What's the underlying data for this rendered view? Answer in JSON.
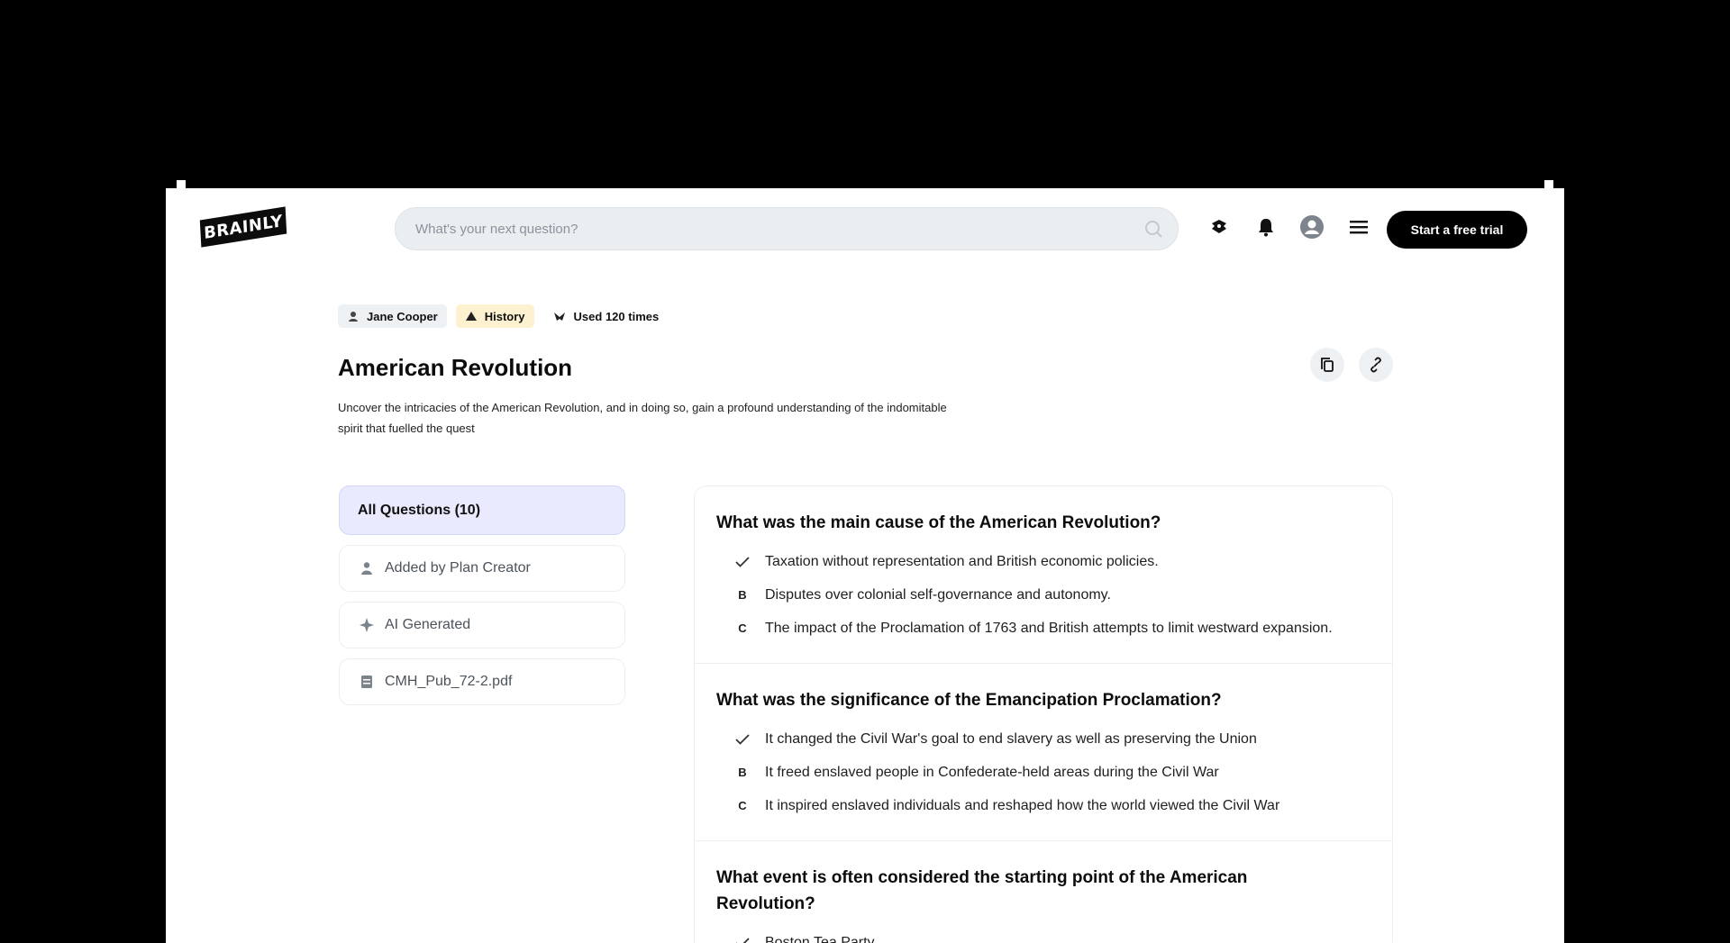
{
  "header": {
    "logo_text": "BRAINLY",
    "search_placeholder": "What's your next question?",
    "cta_label": "Start a free trial"
  },
  "meta": {
    "author": "Jane Cooper",
    "subject": "History",
    "usage": "Used 120 times"
  },
  "page": {
    "title": "American Revolution",
    "description": "Uncover the intricacies of the American Revolution, and in doing so, gain a profound understanding of the indomitable spirit that fuelled the quest"
  },
  "filters": [
    {
      "label": "All Questions (10)",
      "icon": "none",
      "active": true
    },
    {
      "label": "Added by Plan Creator",
      "icon": "person-icon",
      "active": false
    },
    {
      "label": "AI Generated",
      "icon": "sparkle-icon",
      "active": false
    },
    {
      "label": "CMH_Pub_72-2.pdf",
      "icon": "file-icon",
      "active": false
    }
  ],
  "questions": [
    {
      "text": "What was the main cause of the American Revolution?",
      "options": [
        {
          "mark": "check",
          "text": "Taxation without representation and British economic policies."
        },
        {
          "mark": "B",
          "text": "Disputes over colonial self-governance and autonomy."
        },
        {
          "mark": "C",
          "text": "The impact of the Proclamation of 1763 and British attempts to limit westward expansion."
        }
      ]
    },
    {
      "text": "What was the significance of the Emancipation Proclamation?",
      "options": [
        {
          "mark": "check",
          "text": "It changed the Civil War's goal to end slavery as well as preserving the Union"
        },
        {
          "mark": "B",
          "text": "It freed enslaved people in Confederate-held areas during the Civil War"
        },
        {
          "mark": "C",
          "text": "It inspired enslaved individuals and reshaped how the world viewed the Civil War"
        }
      ]
    },
    {
      "text": "What event is often considered the starting point of the American Revolution?",
      "options": [
        {
          "mark": "check",
          "text": "Boston Tea Party"
        }
      ]
    }
  ]
}
